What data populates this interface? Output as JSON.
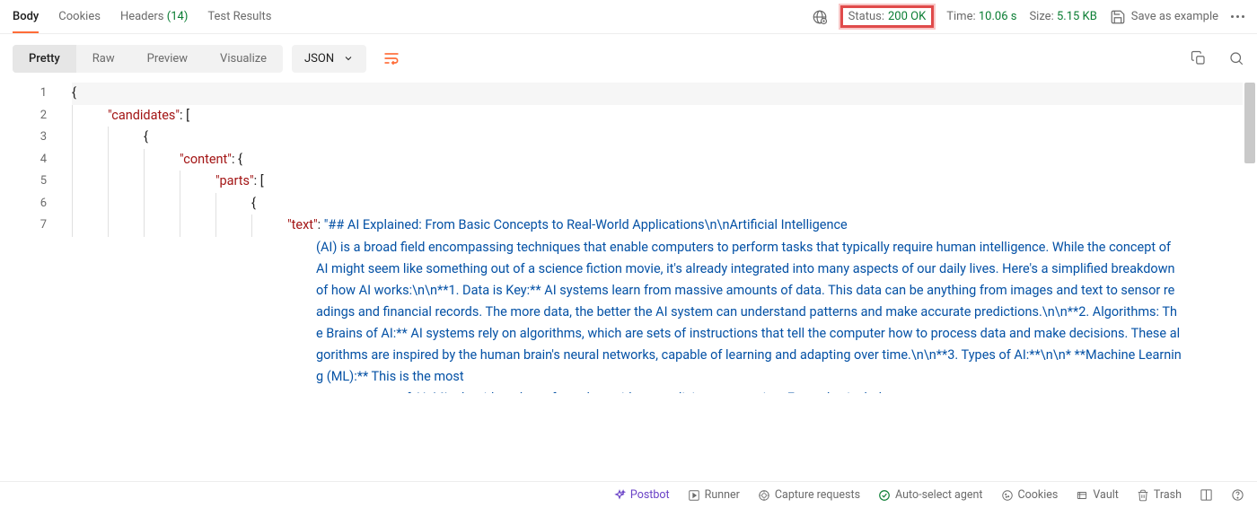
{
  "tabs": {
    "body": "Body",
    "cookies": "Cookies",
    "headers": "Headers",
    "headers_count": "(14)",
    "test_results": "Test Results"
  },
  "meta": {
    "status_label": "Status:",
    "status_value": "200 OK",
    "time_label": "Time:",
    "time_value": "10.06 s",
    "size_label": "Size:",
    "size_value": "5.15 KB",
    "save_example": "Save as example"
  },
  "view_tabs": {
    "pretty": "Pretty",
    "raw": "Raw",
    "preview": "Preview",
    "visualize": "Visualize"
  },
  "dropdown": {
    "label": "JSON"
  },
  "line_numbers": [
    "1",
    "2",
    "3",
    "4",
    "5",
    "6",
    "7"
  ],
  "json_keys": {
    "candidates": "\"candidates\"",
    "content": "\"content\"",
    "parts": "\"parts\"",
    "text": "\"text\""
  },
  "json_punct": {
    "open_brace": "{",
    "colon_space": ": ",
    "open_bracket": "[",
    "close": "}"
  },
  "text_start": "\"## AI Explained: From Basic Concepts to Real-World Applications\\n\\nArtificial Intelligence",
  "text_body": "(AI) is a broad field encompassing techniques that enable computers to perform tasks that typically require human intelligence. While the concept of AI might seem like something out of a science fiction movie, it's already integrated into many aspects of our daily lives. Here's a simplified breakdown of how AI works:\\n\\n**1. Data is Key:** AI systems learn from massive amounts of data. This data can be anything from images and text to sensor readings and financial records. The more data, the better the AI system can understand patterns and make accurate predictions.\\n\\n**2. Algorithms: The Brains of AI:** AI systems rely on algorithms, which are sets of instructions that tell the computer how to process data and make decisions. These algorithms are inspired by the human brain's neural networks, capable of learning and adapting over time.\\n\\n**3. Types of AI:**\\n\\n* **Machine Learning (ML):** This is the most",
  "text_tail": "common type of AI. ML algorithms learn from data without explicit programming. Examples include",
  "bottom": {
    "postbot": "Postbot",
    "runner": "Runner",
    "capture": "Capture requests",
    "auto_select": "Auto-select agent",
    "cookies": "Cookies",
    "vault": "Vault",
    "trash": "Trash"
  }
}
